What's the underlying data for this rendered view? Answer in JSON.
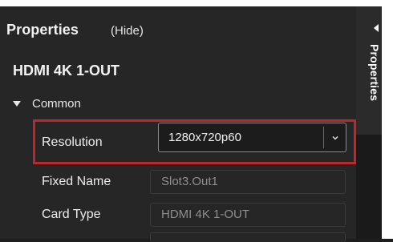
{
  "panel": {
    "title": "Properties",
    "hide_link": "(Hide)",
    "device_name": "HDMI 4K 1-OUT"
  },
  "section": {
    "label": "Common",
    "expanded": true
  },
  "rows": {
    "resolution": {
      "label": "Resolution",
      "value": "1280x720p60"
    },
    "fixed_name": {
      "label": "Fixed Name",
      "value": "Slot3.Out1"
    },
    "card_type": {
      "label": "Card Type",
      "value": "HDMI 4K 1-OUT"
    }
  },
  "side_tab": {
    "label": "Properties"
  },
  "colors": {
    "highlight": "#c0272d",
    "panel_bg": "#262626",
    "text": "#f2f2f2",
    "muted_text": "#8e8e8e"
  }
}
